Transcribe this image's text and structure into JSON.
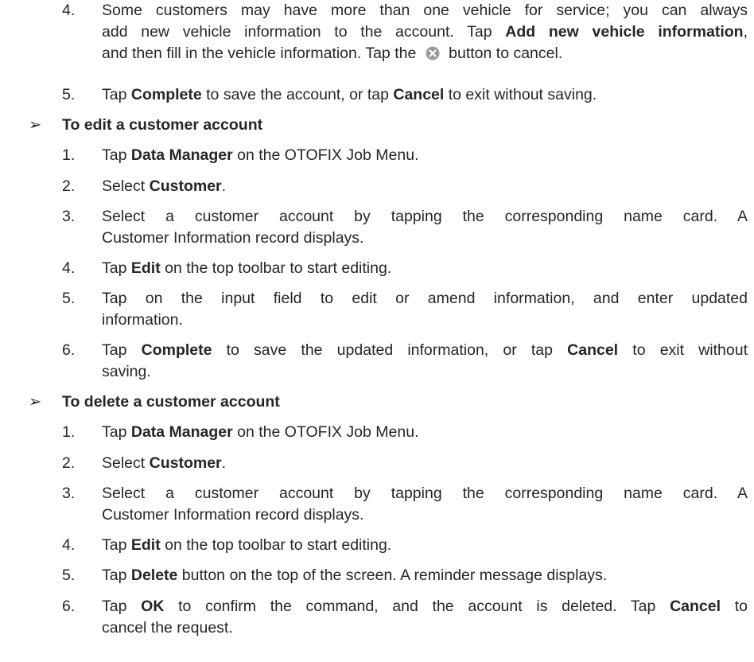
{
  "top_steps": [
    {
      "num": "4.",
      "parts": [
        "Some customers may have more than one vehicle for service; you can always",
        "add new vehicle information to the account. Tap ",
        "Add new vehicle information",
        ",",
        "and then fill in the vehicle information. Tap the ",
        " button to cancel."
      ]
    },
    {
      "num": "5.",
      "parts": [
        "Tap ",
        "Complete",
        " to save the account, or tap ",
        "Cancel",
        " to exit without saving."
      ]
    }
  ],
  "edit_section": {
    "bullet": "➢",
    "heading": "To edit a customer account",
    "steps": [
      {
        "num": "1.",
        "a": "Tap ",
        "b": "Data Manager",
        "c": " on the OTOFIX Job Menu."
      },
      {
        "num": "2.",
        "a": "Select ",
        "b": "Customer",
        "c": "."
      },
      {
        "num": "3.",
        "l1": "Select a customer account by tapping the corresponding name card. A",
        "l2": "Customer Information record displays."
      },
      {
        "num": "4.",
        "a": "Tap ",
        "b": "Edit",
        "c": " on the top toolbar to start editing."
      },
      {
        "num": "5.",
        "l1": "Tap on the input field to edit or amend information, and enter updated",
        "l2": "information."
      },
      {
        "num": "6.",
        "a": "Tap ",
        "b": "Complete",
        "c": " to save the updated information, or tap ",
        "d": "Cancel",
        "e": " to exit without",
        "l2": "saving."
      }
    ]
  },
  "delete_section": {
    "bullet": "➢",
    "heading": "To delete a customer account",
    "steps": [
      {
        "num": "1.",
        "a": "Tap ",
        "b": "Data Manager",
        "c": " on the OTOFIX Job Menu."
      },
      {
        "num": "2.",
        "a": "Select ",
        "b": "Customer",
        "c": "."
      },
      {
        "num": "3.",
        "l1": "Select a customer account by tapping the corresponding name card. A",
        "l2": "Customer Information record displays."
      },
      {
        "num": "4.",
        "a": "Tap ",
        "b": "Edit",
        "c": " on the top toolbar to start editing."
      },
      {
        "num": "5.",
        "a": "Tap ",
        "b": "Delete",
        "c": " button on the top of the screen. A reminder message displays."
      },
      {
        "num": "6.",
        "a": "Tap ",
        "b": "OK",
        "c": " to confirm the command, and the account is deleted. Tap ",
        "d": "Cancel",
        "e": " to",
        "l2": "cancel the request."
      }
    ]
  },
  "icons": {
    "cancel": "close-circle-icon"
  }
}
